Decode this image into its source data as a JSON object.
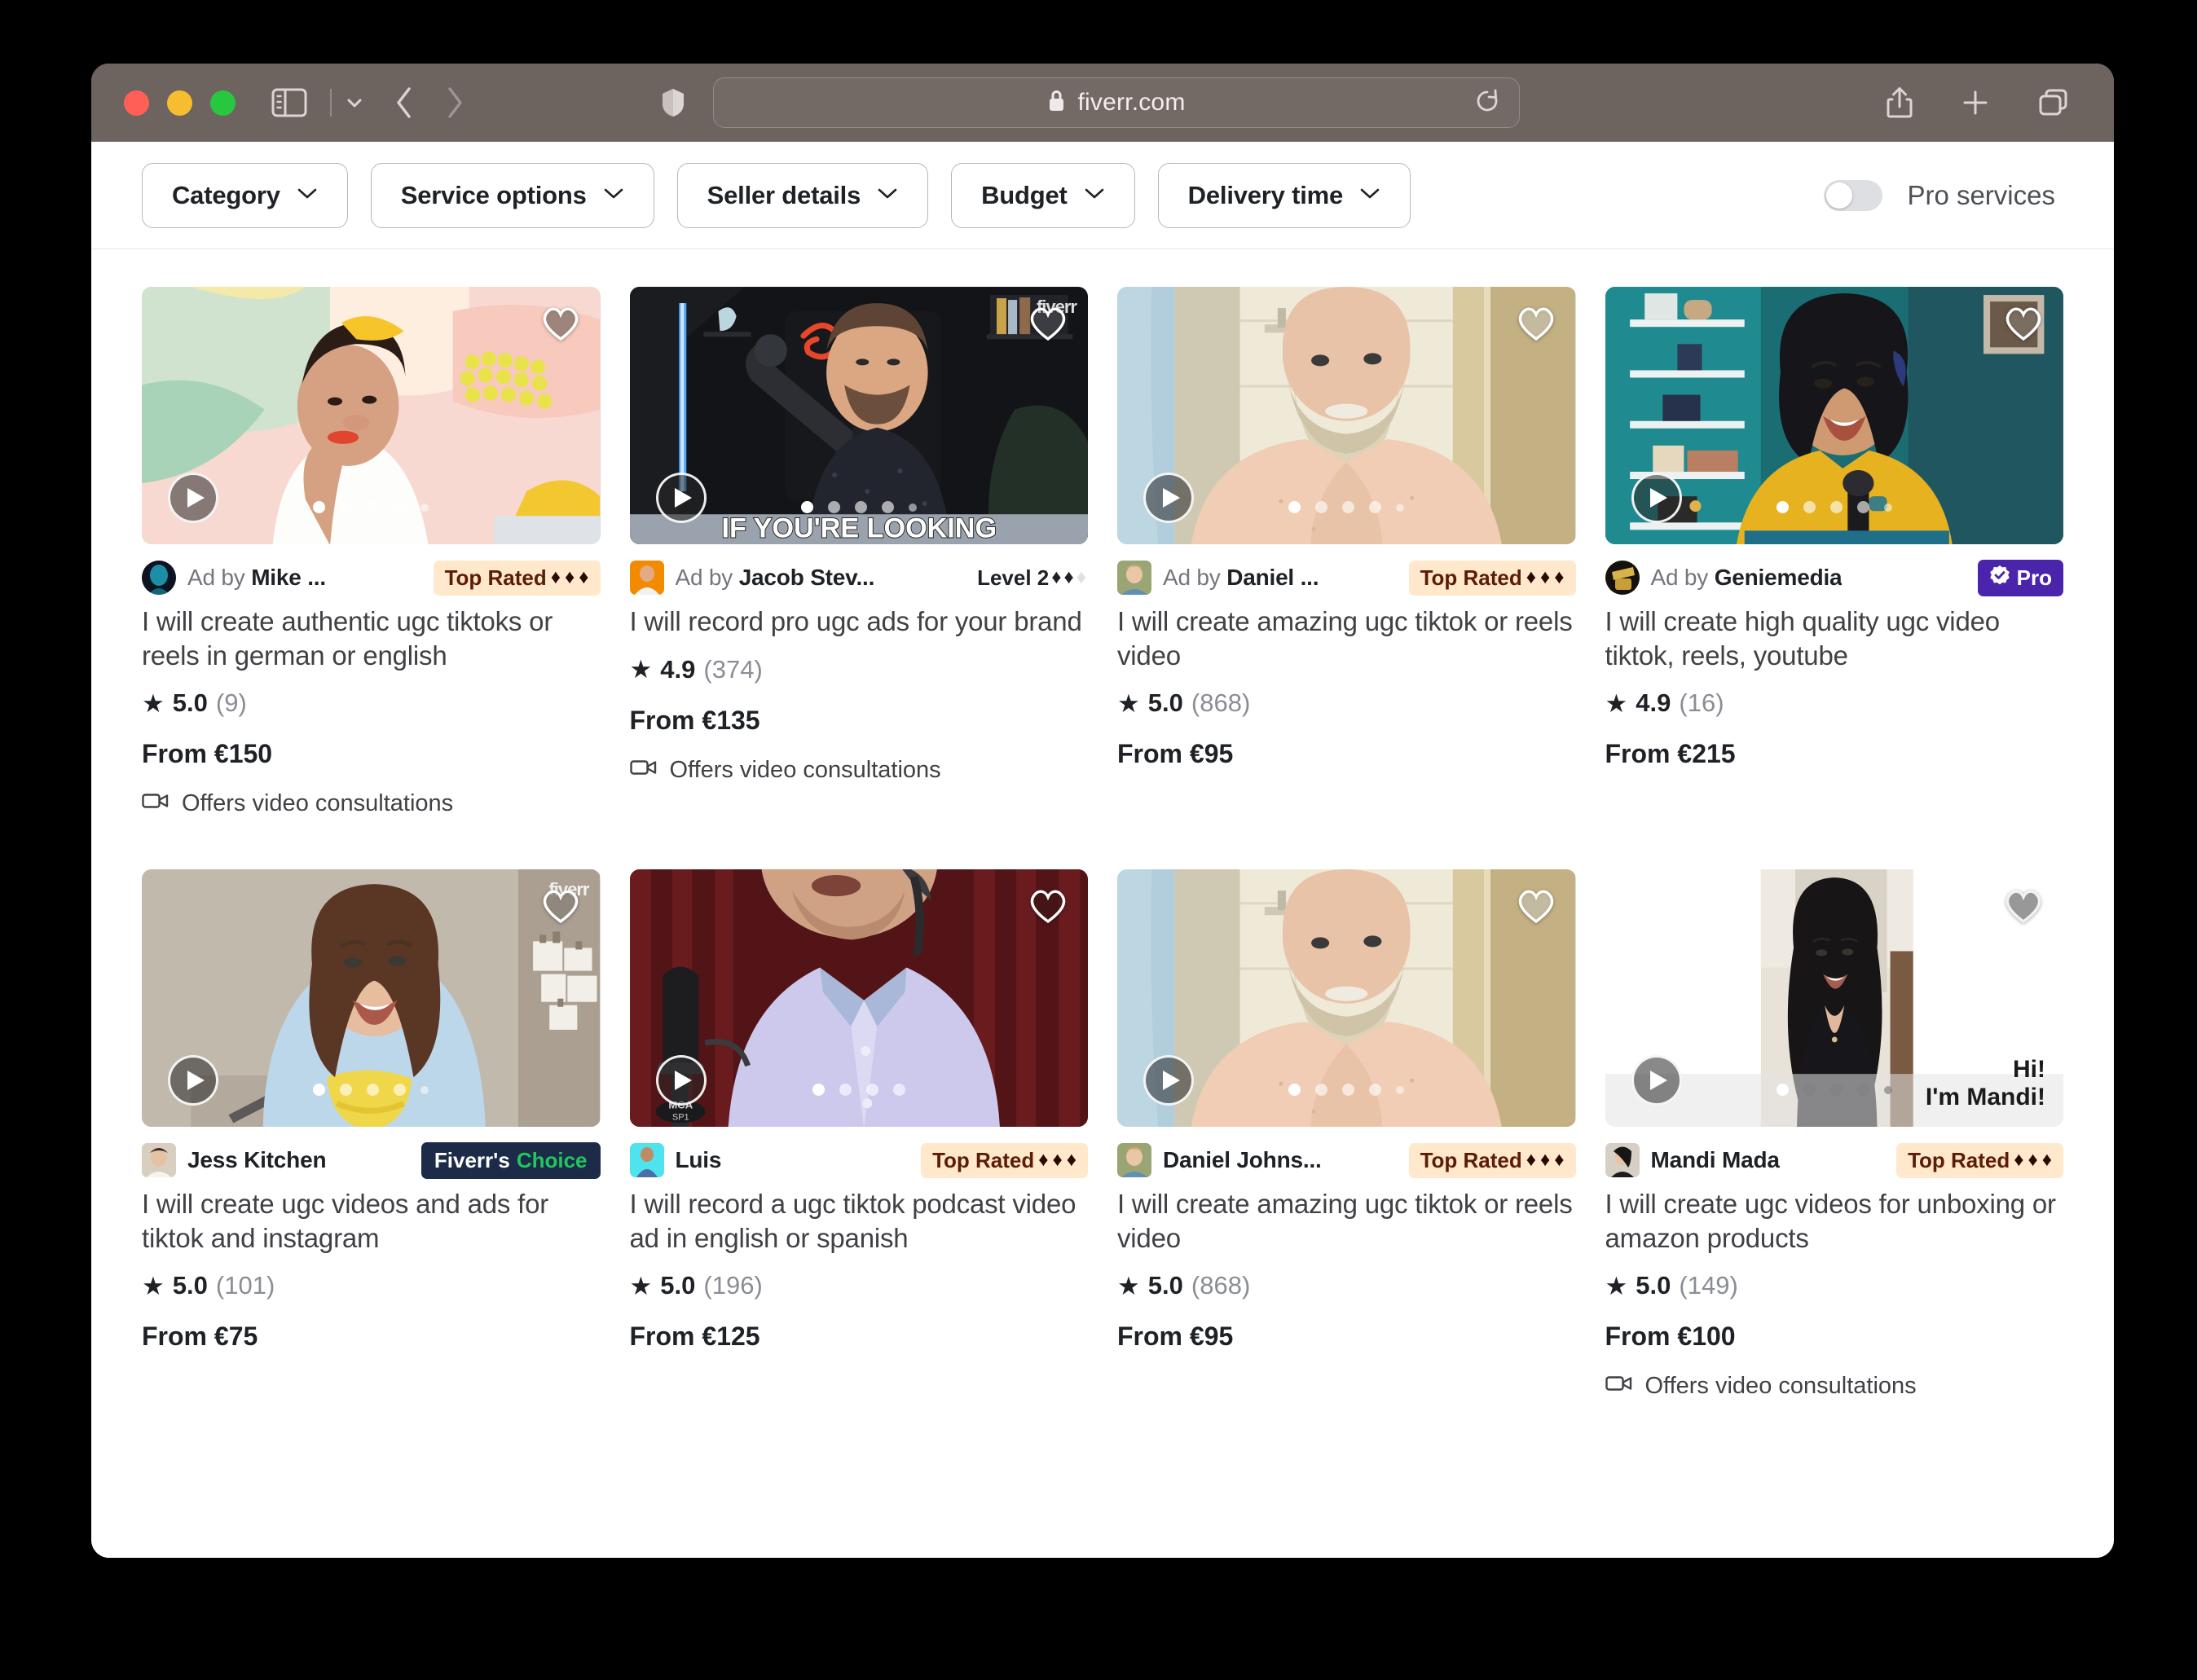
{
  "browser": {
    "url": "fiverr.com",
    "lock_icon": "lock-icon",
    "shield_icon": "privacy-shield-icon",
    "sidebar_icon": "sidebar-toggle-icon",
    "back_icon": "back-chevron-icon",
    "forward_icon": "forward-chevron-icon",
    "reload_icon": "reload-icon",
    "share_icon": "share-icon",
    "newtab_icon": "plus-icon",
    "tabs_icon": "tab-overview-icon"
  },
  "filters": {
    "pills": [
      {
        "label": "Category",
        "icon": "chevron-down-icon"
      },
      {
        "label": "Service options",
        "icon": "chevron-down-icon"
      },
      {
        "label": "Seller details",
        "icon": "chevron-down-icon"
      },
      {
        "label": "Budget",
        "icon": "chevron-down-icon"
      },
      {
        "label": "Delivery time",
        "icon": "chevron-down-icon"
      }
    ],
    "pro_services_label": "Pro services",
    "pro_services_on": false
  },
  "cards": [
    {
      "seller_prefix": "Ad by ",
      "seller_name": "Mike ...",
      "badge_type": "top-rated",
      "badge_label": "Top Rated",
      "badge_diamonds": 3,
      "title": "I will create authentic ugc tiktoks or reels in german or english",
      "rating": "5.0",
      "reviews": "(9)",
      "price": "From €150",
      "consultations": "Offers video consultations",
      "dots": 5,
      "watermark": ""
    },
    {
      "seller_prefix": "Ad by ",
      "seller_name": "Jacob Stev...",
      "badge_type": "level",
      "badge_label": "Level 2",
      "badge_diamonds": 2,
      "title": "I will record pro ugc ads for your brand",
      "rating": "4.9",
      "reviews": "(374)",
      "price": "From €135",
      "consultations": "Offers video consultations",
      "dots": 5,
      "caption": "IF YOU'RE LOOKING",
      "watermark": "fiverr"
    },
    {
      "seller_prefix": "Ad by ",
      "seller_name": "Daniel ...",
      "badge_type": "top-rated",
      "badge_label": "Top Rated",
      "badge_diamonds": 3,
      "title": "I will create amazing ugc tiktok or reels video",
      "rating": "5.0",
      "reviews": "(868)",
      "price": "From €95",
      "consultations": "",
      "dots": 5,
      "watermark": ""
    },
    {
      "seller_prefix": "Ad by ",
      "seller_name": "Geniemedia",
      "badge_type": "pro",
      "badge_label": "Pro",
      "badge_diamonds": 0,
      "title": "I will create high quality ugc video tiktok, reels, youtube",
      "rating": "4.9",
      "reviews": "(16)",
      "price": "From €215",
      "consultations": "",
      "dots": 5,
      "watermark": ""
    },
    {
      "seller_prefix": "",
      "seller_name": "Jess Kitchen",
      "badge_type": "choice",
      "badge_label_white": "Fiverr's",
      "badge_label_green": "Choice",
      "title": "I will create ugc videos and ads for tiktok and instagram",
      "rating": "5.0",
      "reviews": "(101)",
      "price": "From €75",
      "consultations": "",
      "dots": 5,
      "watermark": "fiverr"
    },
    {
      "seller_prefix": "",
      "seller_name": "Luis",
      "badge_type": "top-rated",
      "badge_label": "Top Rated",
      "badge_diamonds": 3,
      "title": "I will record a ugc tiktok podcast video ad in english or spanish",
      "rating": "5.0",
      "reviews": "(196)",
      "price": "From €125",
      "consultations": "",
      "dots": 4,
      "watermark": ""
    },
    {
      "seller_prefix": "",
      "seller_name": "Daniel Johns...",
      "badge_type": "top-rated",
      "badge_label": "Top Rated",
      "badge_diamonds": 3,
      "title": "I will create amazing ugc tiktok or reels video",
      "rating": "5.0",
      "reviews": "(868)",
      "price": "From €95",
      "consultations": "",
      "dots": 5,
      "watermark": ""
    },
    {
      "seller_prefix": "",
      "seller_name": "Mandi Mada",
      "badge_type": "top-rated",
      "badge_label": "Top Rated",
      "badge_diamonds": 3,
      "title": "I will create ugc videos for unboxing or amazon products",
      "rating": "5.0",
      "reviews": "(149)",
      "price": "From €100",
      "consultations": "Offers video consultations",
      "dots": 5,
      "overlay_line1": "Hi!",
      "overlay_line2": "I'm Mandi!",
      "watermark": ""
    }
  ],
  "colors": {
    "top_rated_bg": "#ffe8cc",
    "top_rated_text": "#5c1c06",
    "pro_bg": "#4a24aa",
    "choice_bg": "#1c2b47",
    "choice_green": "#22c55e",
    "toolbar_bg": "#6d635f"
  }
}
